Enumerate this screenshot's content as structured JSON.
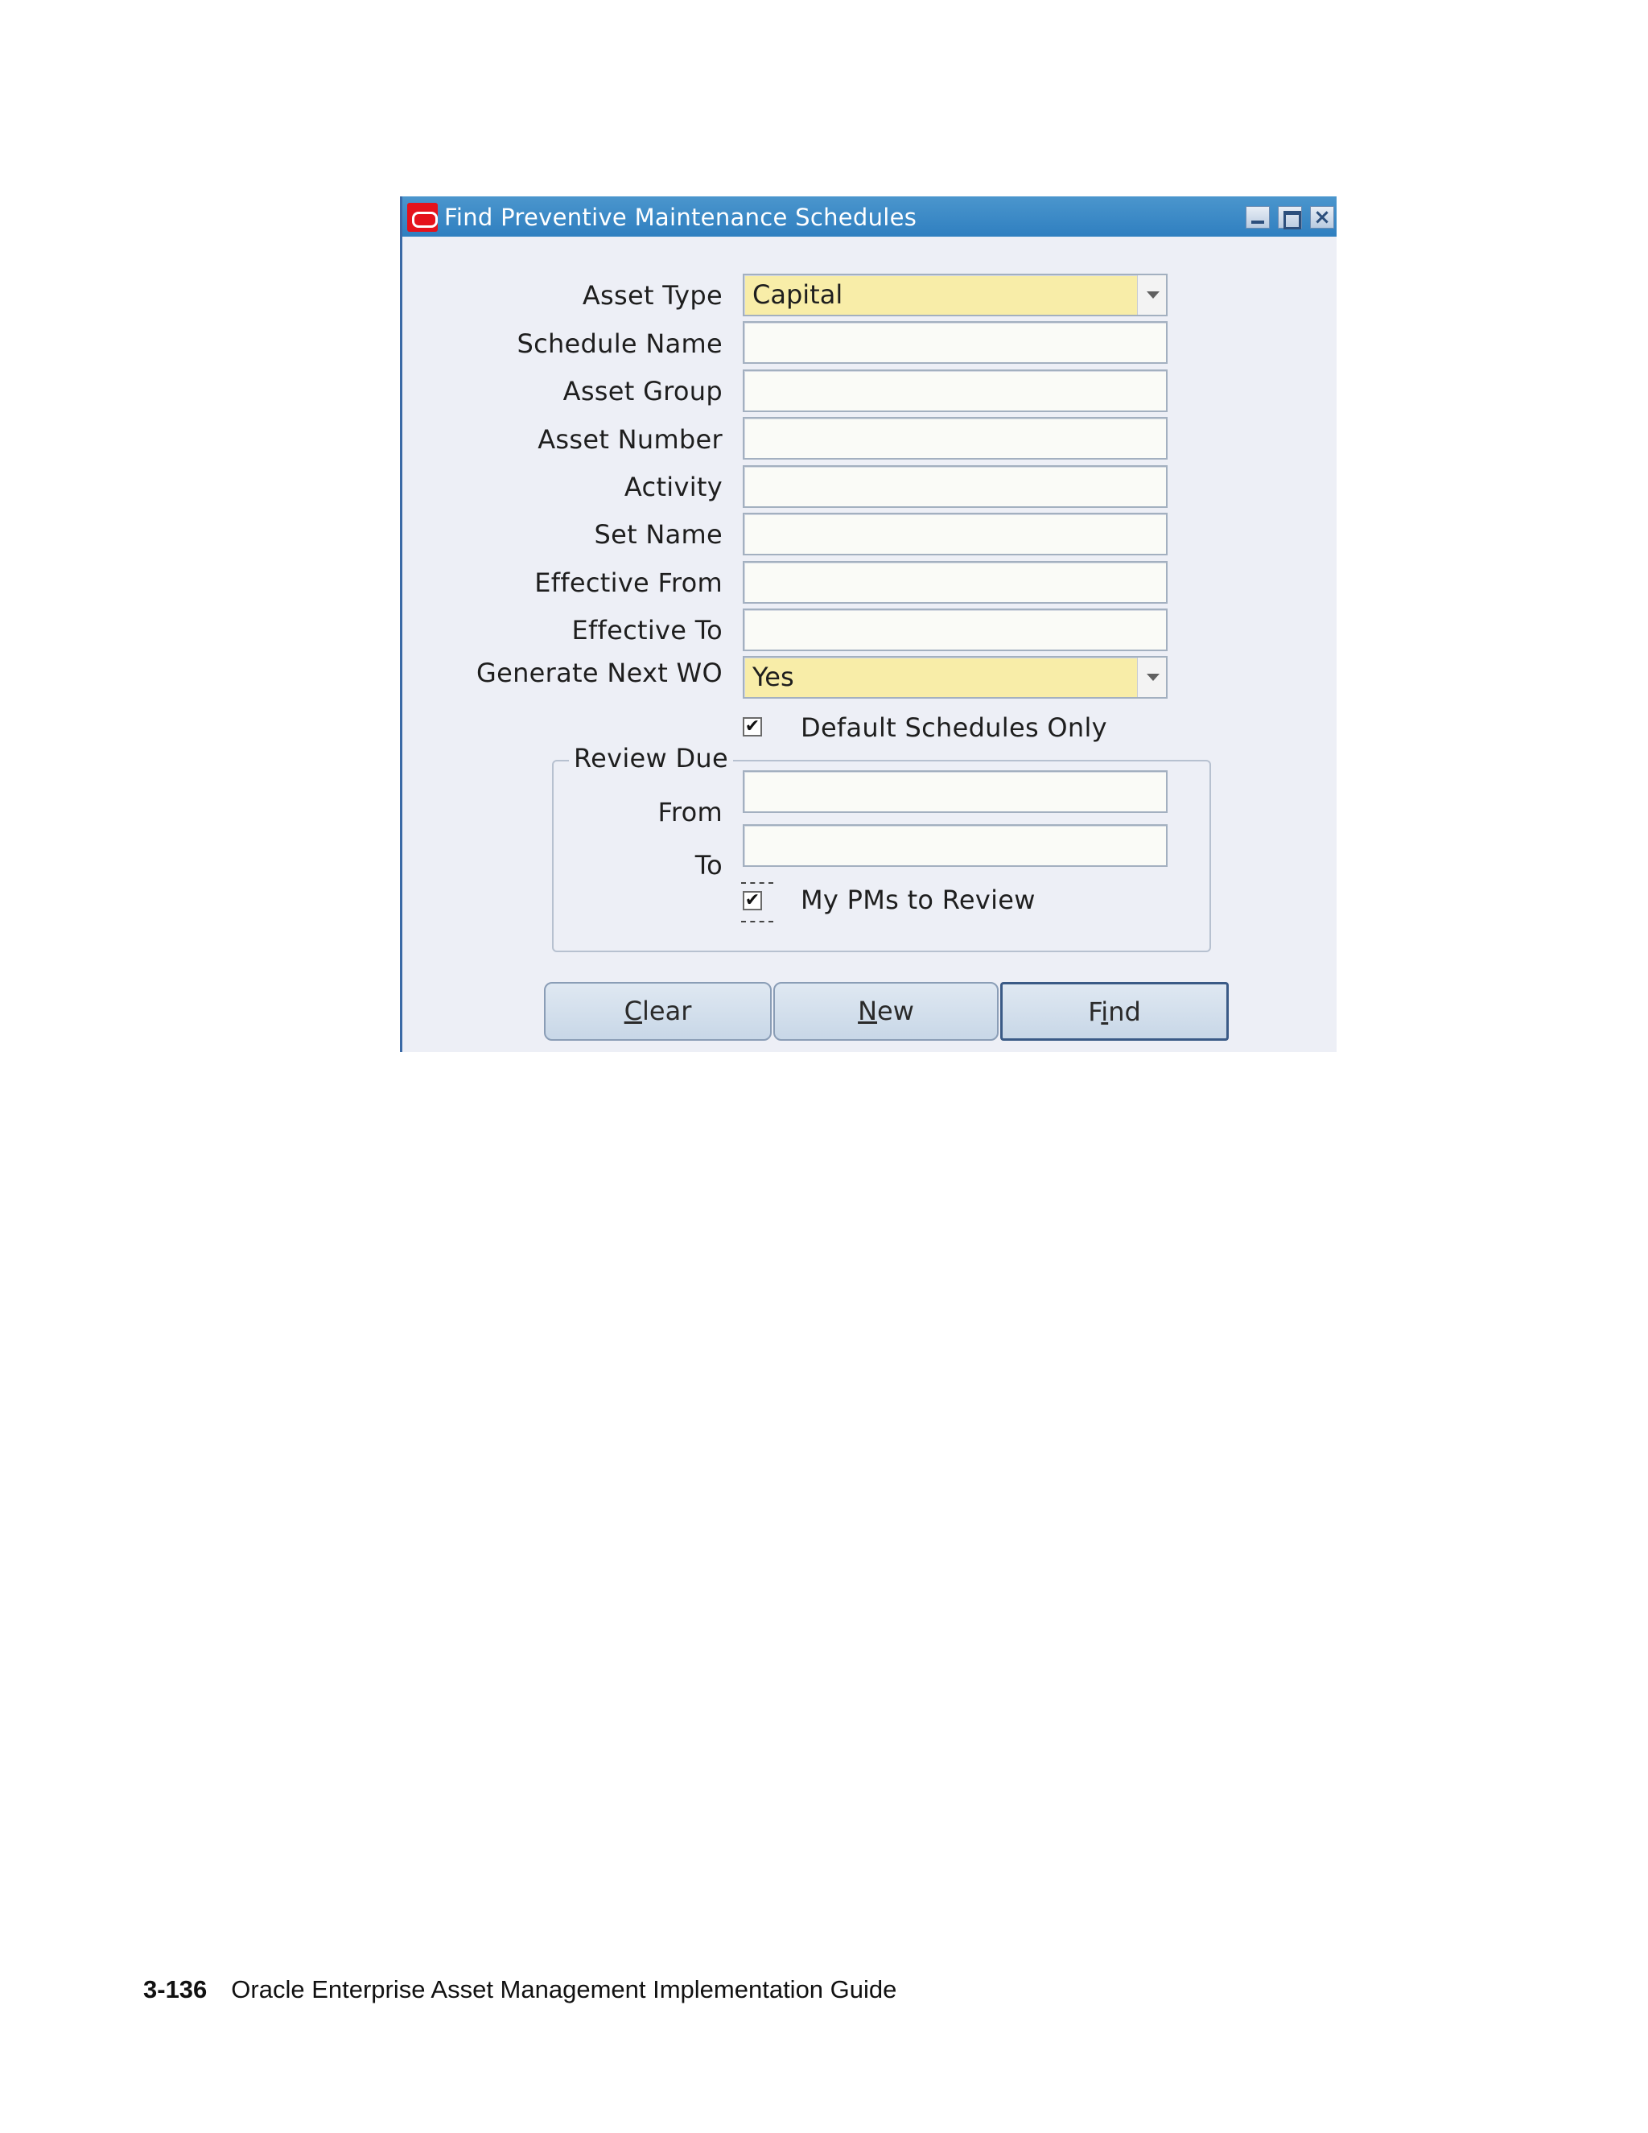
{
  "window": {
    "title": "Find Preventive Maintenance Schedules"
  },
  "form": {
    "asset_type": {
      "label": "Asset Type",
      "value": "Capital"
    },
    "schedule_name": {
      "label": "Schedule Name",
      "value": ""
    },
    "asset_group": {
      "label": "Asset Group",
      "value": ""
    },
    "asset_number": {
      "label": "Asset Number",
      "value": ""
    },
    "activity": {
      "label": "Activity",
      "value": ""
    },
    "set_name": {
      "label": "Set Name",
      "value": ""
    },
    "effective_from": {
      "label": "Effective From",
      "value": ""
    },
    "effective_to": {
      "label": "Effective To",
      "value": ""
    },
    "generate_next_wo": {
      "label": "Generate Next WO",
      "value": "Yes"
    },
    "default_schedules_only": {
      "label": "Default Schedules Only",
      "checked": true,
      "mark": "✔"
    }
  },
  "review_due": {
    "title": "Review Due",
    "from": {
      "label": "From",
      "value": ""
    },
    "to": {
      "label": "To",
      "value": ""
    },
    "my_pms": {
      "label": "My PMs to Review",
      "checked": true,
      "mark": "✔"
    }
  },
  "buttons": {
    "clear": {
      "first": "C",
      "rest": "lear"
    },
    "new": {
      "first": "N",
      "rest": "ew"
    },
    "find": {
      "pre": "F",
      "underline": "i",
      "rest": "nd"
    }
  },
  "footer": {
    "page_number": "3-136",
    "title": "Oracle Enterprise Asset Management Implementation Guide"
  }
}
